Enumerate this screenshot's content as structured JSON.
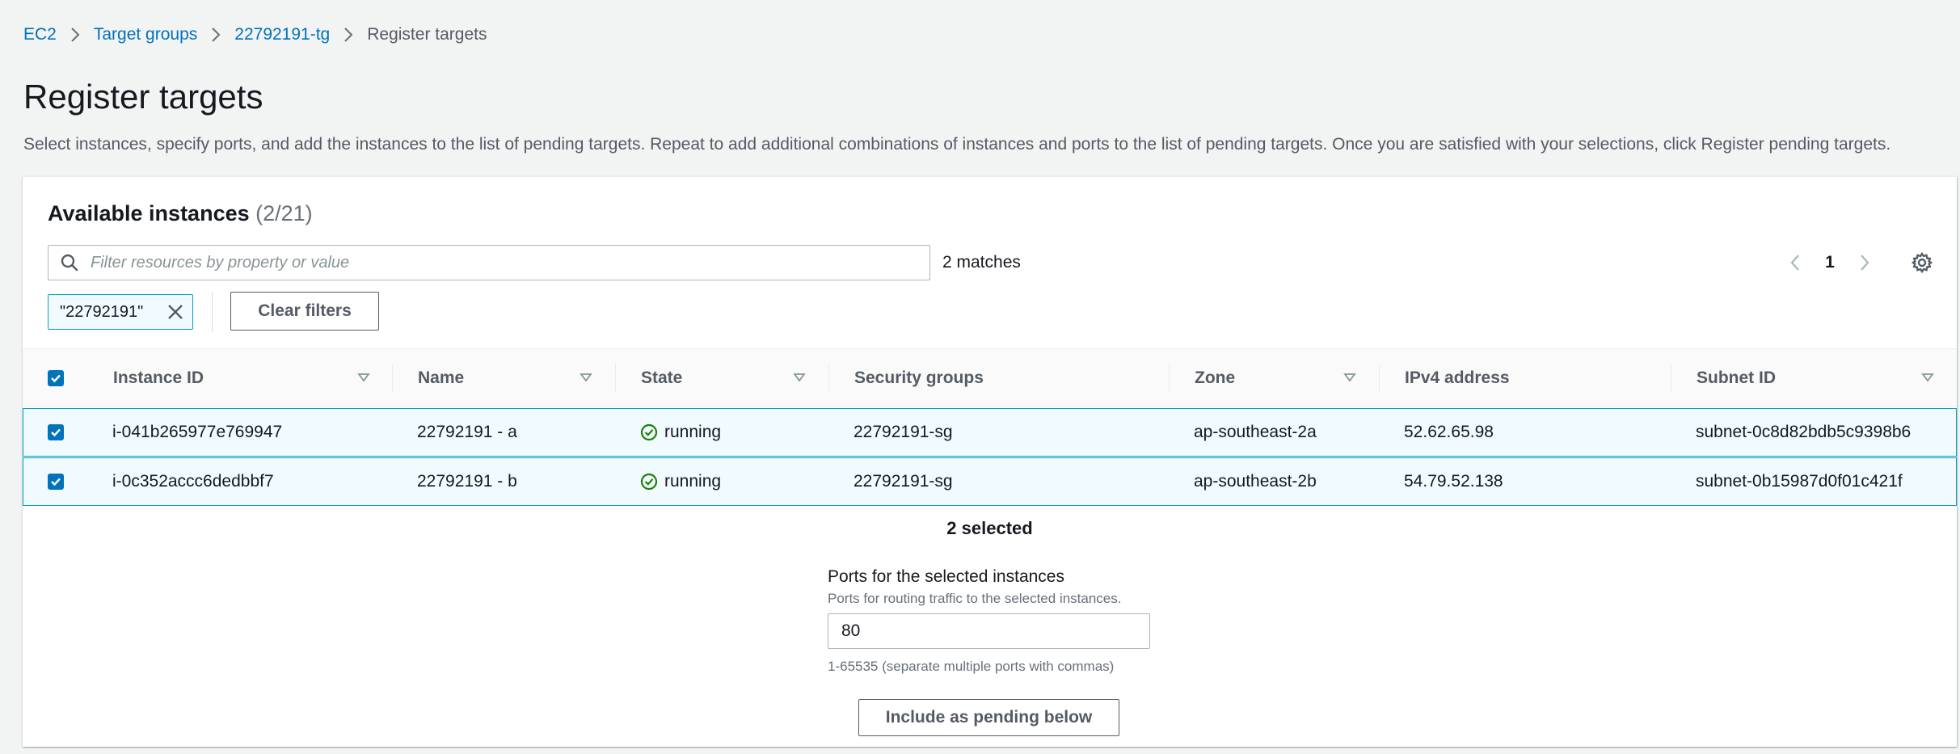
{
  "breadcrumb": {
    "items": [
      {
        "label": "EC2"
      },
      {
        "label": "Target groups"
      },
      {
        "label": "22792191-tg"
      },
      {
        "label": "Register targets"
      }
    ]
  },
  "page": {
    "title": "Register targets",
    "description": "Select instances, specify ports, and add the instances to the list of pending targets. Repeat to add additional combinations of instances and ports to the list of pending targets. Once you are satisfied with your selections, click Register pending targets."
  },
  "panel": {
    "title": "Available instances",
    "count": "(2/21)",
    "filter_placeholder": "Filter resources by property or value",
    "matches": "2 matches",
    "current_page": "1",
    "token": "\"22792191\"",
    "clear_filters_label": "Clear filters"
  },
  "table": {
    "columns": [
      "Instance ID",
      "Name",
      "State",
      "Security groups",
      "Zone",
      "IPv4 address",
      "Subnet ID"
    ],
    "rows": [
      {
        "instance_id": "i-041b265977e769947",
        "name": "22792191 - a",
        "state": "running",
        "security_groups": "22792191-sg",
        "zone": "ap-southeast-2a",
        "ipv4": "52.62.65.98",
        "subnet": "subnet-0c8d82bdb5c9398b6"
      },
      {
        "instance_id": "i-0c352accc6dedbbf7",
        "name": "22792191 - b",
        "state": "running",
        "security_groups": "22792191-sg",
        "zone": "ap-southeast-2b",
        "ipv4": "54.79.52.138",
        "subnet": "subnet-0b15987d0f01c421f"
      }
    ]
  },
  "selection": {
    "selected_text": "2 selected",
    "ports_label": "Ports for the selected instances",
    "ports_description": "Ports for routing traffic to the selected instances.",
    "ports_value": "80",
    "ports_hint": "1-65535 (separate multiple ports with commas)",
    "include_button": "Include as pending below"
  },
  "colors": {
    "link": "#0073bb",
    "selected_row_bg": "#f1faff",
    "selected_row_border": "#00a1c9",
    "running": "#1d8102"
  }
}
